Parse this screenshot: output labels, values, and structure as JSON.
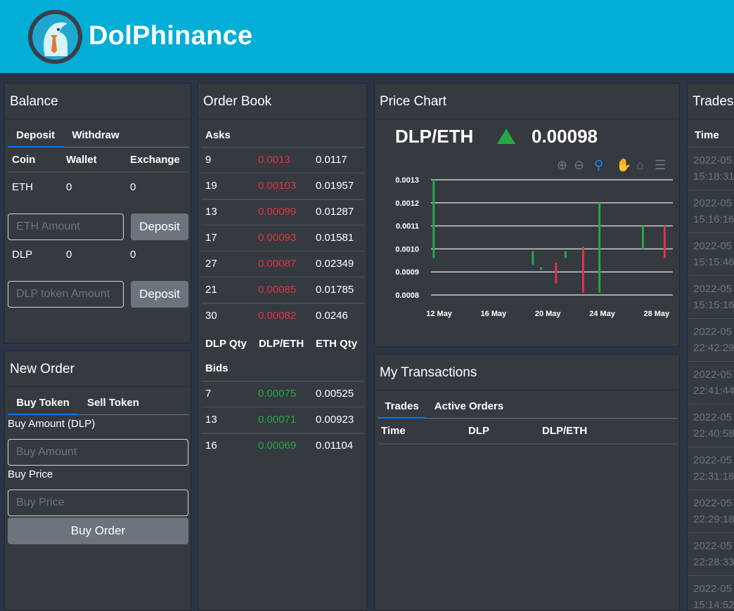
{
  "app": {
    "title": "DolPhinance"
  },
  "balance": {
    "title": "Balance",
    "tabs": [
      "Deposit",
      "Withdraw"
    ],
    "headers": [
      "Coin",
      "Wallet",
      "Exchange"
    ],
    "rows": [
      {
        "coin": "ETH",
        "wallet": "0",
        "exchange": "0"
      },
      {
        "coin": "DLP",
        "wallet": "0",
        "exchange": "0"
      }
    ],
    "eth_placeholder": "ETH Amount",
    "dlp_placeholder": "DLP token Amount",
    "deposit_label": "Deposit"
  },
  "new_order": {
    "title": "New Order",
    "tabs": [
      "Buy Token",
      "Sell Token"
    ],
    "amount_label": "Buy Amount (DLP)",
    "amount_placeholder": "Buy Amount",
    "price_label": "Buy Price",
    "price_placeholder": "Buy Price",
    "submit_label": "Buy Order"
  },
  "order_book": {
    "title": "Order Book",
    "asks_label": "Asks",
    "bids_label": "Bids",
    "columns": [
      "DLP Qty",
      "DLP/ETH",
      "ETH Qty"
    ],
    "asks": [
      {
        "qty": "9",
        "price": "0.0013",
        "eth": "0.0117"
      },
      {
        "qty": "19",
        "price": "0.00103",
        "eth": "0.01957"
      },
      {
        "qty": "13",
        "price": "0.00099",
        "eth": "0.01287"
      },
      {
        "qty": "17",
        "price": "0.00093",
        "eth": "0.01581"
      },
      {
        "qty": "27",
        "price": "0.00087",
        "eth": "0.02349"
      },
      {
        "qty": "21",
        "price": "0.00085",
        "eth": "0.01785"
      },
      {
        "qty": "30",
        "price": "0.00082",
        "eth": "0.0246"
      }
    ],
    "bids": [
      {
        "qty": "7",
        "price": "0.00075",
        "eth": "0.00525"
      },
      {
        "qty": "13",
        "price": "0.00071",
        "eth": "0.00923"
      },
      {
        "qty": "16",
        "price": "0.00069",
        "eth": "0.01104"
      }
    ]
  },
  "price_chart": {
    "title": "Price Chart",
    "pair": "DLP/ETH",
    "last_price": "0.00098",
    "trend": "up",
    "colors": {
      "up": "#28a745",
      "down": "#dc3545",
      "grid": "#c8cdd2"
    }
  },
  "chart_data": {
    "type": "candlestick",
    "title": "",
    "xlabel": "",
    "ylabel": "",
    "ylim": [
      0.0008,
      0.0013
    ],
    "y_ticks": [
      "0.0008",
      "0.0009",
      "0.0010",
      "0.0011",
      "0.0012",
      "0.0013"
    ],
    "x_ticks": [
      "12 May",
      "16 May",
      "20 May",
      "24 May",
      "28 May"
    ],
    "x_domain": [
      11.4,
      29.2
    ],
    "grid": true,
    "candles": [
      {
        "day": 11.6,
        "open": 0.00096,
        "close": 0.0013,
        "low": 0.00096,
        "high": 0.0013
      },
      {
        "day": 18.9,
        "open": 0.00093,
        "close": 0.00099,
        "low": 0.00093,
        "high": 0.00099
      },
      {
        "day": 19.5,
        "open": 0.00091,
        "close": 0.00092,
        "low": 0.00091,
        "high": 0.00092
      },
      {
        "day": 20.6,
        "open": 0.00094,
        "close": 0.00085,
        "low": 0.00085,
        "high": 0.00094
      },
      {
        "day": 21.3,
        "open": 0.00096,
        "close": 0.00099,
        "low": 0.00096,
        "high": 0.00099
      },
      {
        "day": 22.6,
        "open": 0.00101,
        "close": 0.00081,
        "low": 0.00081,
        "high": 0.00101
      },
      {
        "day": 23.8,
        "open": 0.00081,
        "close": 0.0012,
        "low": 0.00081,
        "high": 0.0012
      },
      {
        "day": 27.0,
        "open": 0.001,
        "close": 0.0011,
        "low": 0.001,
        "high": 0.0011
      },
      {
        "day": 28.6,
        "open": 0.0011,
        "close": 0.00096,
        "low": 0.00096,
        "high": 0.0011
      }
    ]
  },
  "my_transactions": {
    "title": "My Transactions",
    "tabs": [
      "Trades",
      "Active Orders"
    ],
    "columns": [
      "Time",
      "DLP",
      "DLP/ETH"
    ]
  },
  "trades": {
    "title": "Trades",
    "columns": [
      "Time"
    ],
    "rows": [
      {
        "date": "2022-05",
        "time": "15:18:31"
      },
      {
        "date": "2022-05",
        "time": "15:16:16"
      },
      {
        "date": "2022-05",
        "time": "15:15:46"
      },
      {
        "date": "2022-05",
        "time": "15:15:16"
      },
      {
        "date": "2022-05",
        "time": "22:42:29"
      },
      {
        "date": "2022-05",
        "time": "22:41:44"
      },
      {
        "date": "2022-05",
        "time": "22:40:58"
      },
      {
        "date": "2022-05",
        "time": "22:31:18"
      },
      {
        "date": "2022-05",
        "time": "22:29:18"
      },
      {
        "date": "2022-05",
        "time": "22:28:33"
      },
      {
        "date": "2022-05",
        "time": "15:14:52"
      }
    ]
  }
}
